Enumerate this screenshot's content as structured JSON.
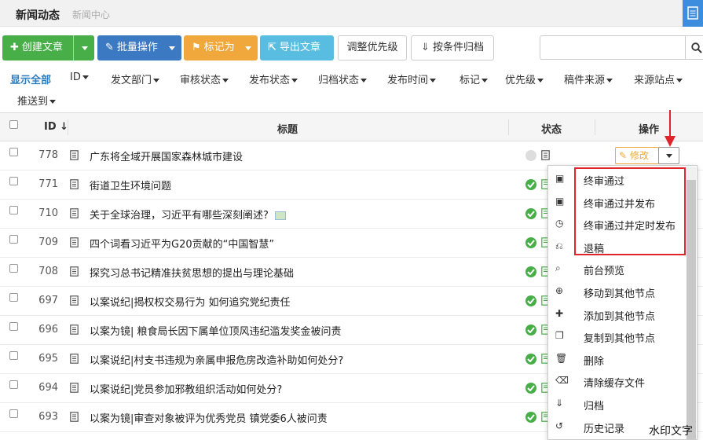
{
  "header": {
    "title": "新闻动态",
    "breadcrumb": "新闻中心"
  },
  "toolbar": {
    "create": "创建文章",
    "batch": "批量操作",
    "mark": "标记为",
    "export": "导出文章",
    "priority": "调整优先级",
    "archive": "按条件归档"
  },
  "filters": {
    "show_all": "显示全部",
    "items": [
      "ID",
      "发文部门",
      "审核状态",
      "发布状态",
      "归档状态",
      "发布时间",
      "标记",
      "优先级",
      "稿件来源",
      "来源站点",
      "推送到"
    ]
  },
  "table": {
    "headers": {
      "id": "ID",
      "title": "标题",
      "status": "状态",
      "action": "操作"
    },
    "rows": [
      {
        "id": "778",
        "title": "广东将全域开展国家森林城市建设",
        "status": "pending"
      },
      {
        "id": "771",
        "title": "街道卫生环境问题",
        "status": "approved"
      },
      {
        "id": "710",
        "title": "关于全球治理，习近平有哪些深刻阐述?",
        "status": "approved",
        "has_image": true
      },
      {
        "id": "709",
        "title": "四个词看习近平为G20贡献的“中国智慧”",
        "status": "approved"
      },
      {
        "id": "708",
        "title": "探究习总书记精准扶贫思想的提出与理论基础",
        "status": "approved"
      },
      {
        "id": "697",
        "title": "以案说纪|揭权权交易行为 如何追究党纪责任",
        "status": "approved"
      },
      {
        "id": "696",
        "title": "以案为镜| 粮食局长因下属单位顶风违纪滥发奖金被问责",
        "status": "approved"
      },
      {
        "id": "695",
        "title": "以案说纪|村支书违规为亲属申报危房改造补助如何处分?",
        "status": "approved"
      },
      {
        "id": "694",
        "title": "以案说纪|党员参加邪教组织活动如何处分?",
        "status": "approved"
      },
      {
        "id": "693",
        "title": "以案为镜|审查对象被评为优秀党员 镇党委6人被问责",
        "status": "approved"
      }
    ],
    "edit_label": "修改"
  },
  "dropdown": {
    "items": [
      {
        "label": "终审通过",
        "icon": "approve-icon"
      },
      {
        "label": "终审通过并发布",
        "icon": "approve-publish-icon"
      },
      {
        "label": "终审通过并定时发布",
        "icon": "clock-icon"
      },
      {
        "label": "退稿",
        "icon": "reject-icon"
      },
      {
        "label": "前台预览",
        "icon": "preview-icon"
      },
      {
        "label": "移动到其他节点",
        "icon": "move-icon"
      },
      {
        "label": "添加到其他节点",
        "icon": "plus-icon"
      },
      {
        "label": "复制到其他节点",
        "icon": "copy-icon"
      },
      {
        "label": "删除",
        "icon": "trash-icon"
      },
      {
        "label": "清除缓存文件",
        "icon": "clear-cache-icon"
      },
      {
        "label": "归档",
        "icon": "archive-icon"
      },
      {
        "label": "历史记录",
        "icon": "history-icon"
      }
    ]
  },
  "watermark": "水印文字",
  "colors": {
    "accent": "#3b79c2",
    "green": "#48ae48",
    "orange": "#f0a83c",
    "cyan": "#58bde0",
    "highlight": "#e0242b"
  }
}
